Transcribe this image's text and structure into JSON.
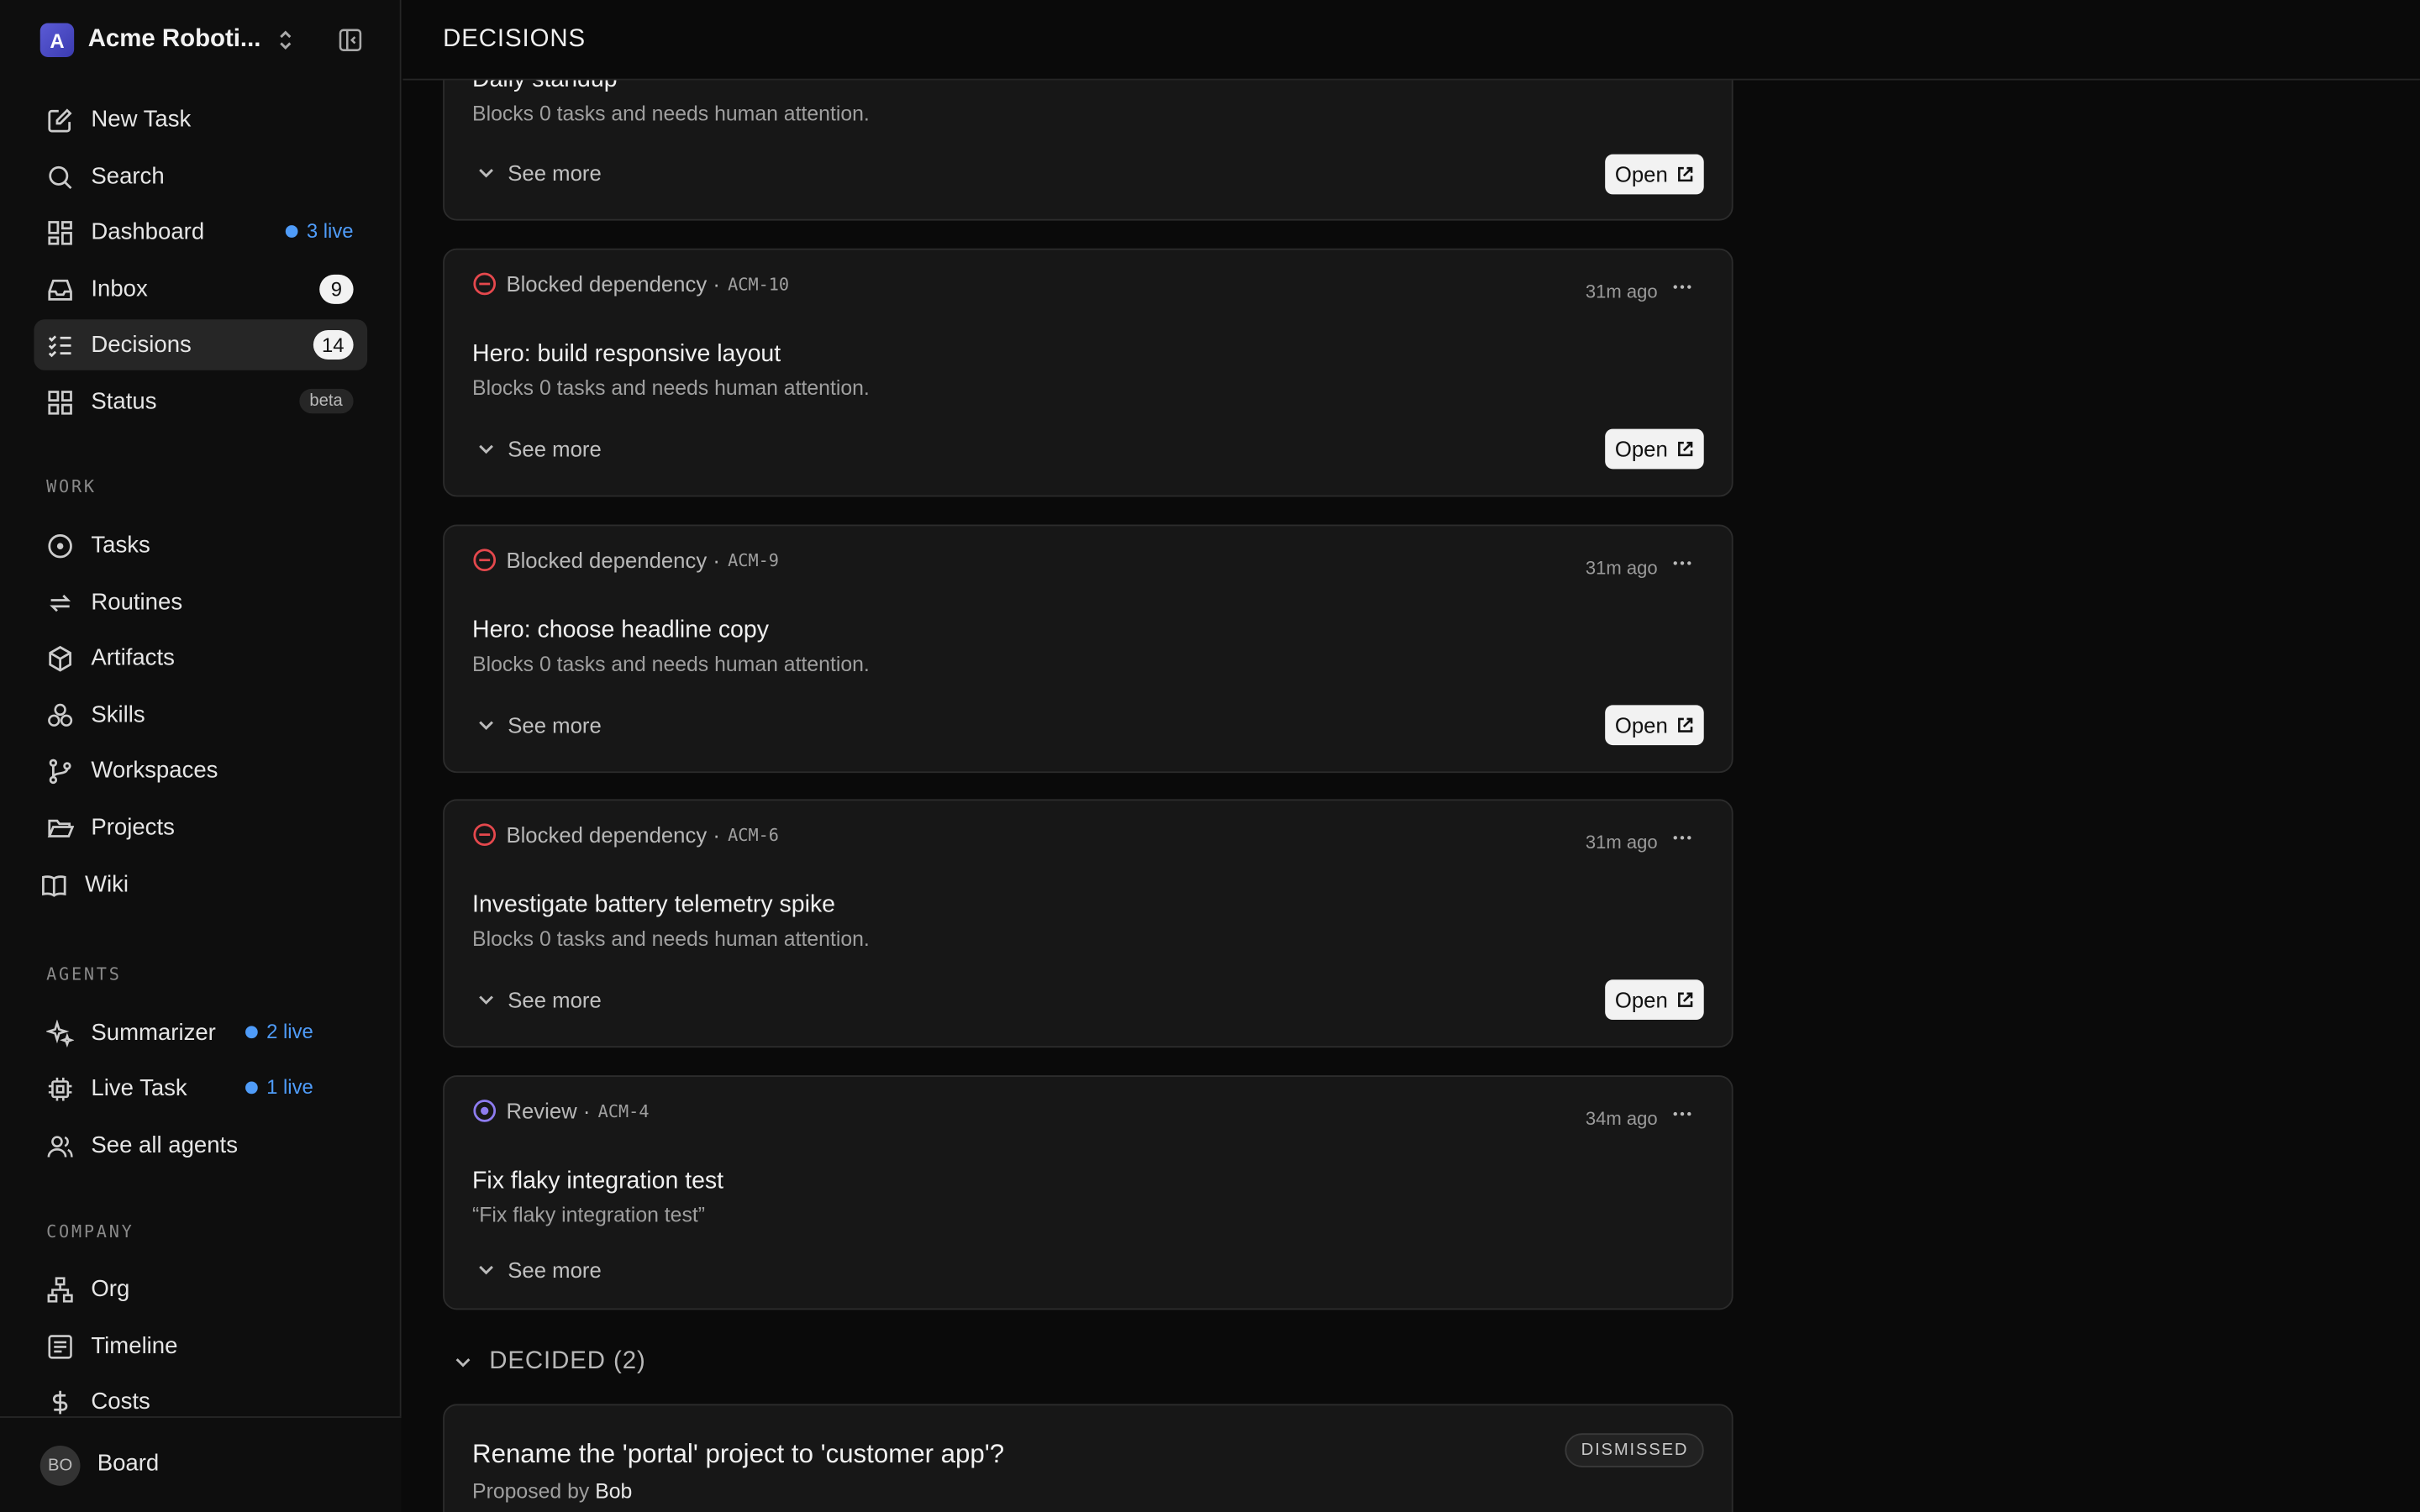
{
  "org": {
    "initial": "A",
    "name": "Acme Roboti..."
  },
  "nav": [
    {
      "label": "New Task"
    },
    {
      "label": "Search"
    },
    {
      "label": "Dashboard",
      "live": "3 live"
    },
    {
      "label": "Inbox",
      "badge": "9"
    },
    {
      "label": "Decisions",
      "badge": "14"
    },
    {
      "label": "Status",
      "tag": "beta"
    }
  ],
  "sections": {
    "work": "WORK",
    "agents": "AGENTS",
    "company": "COMPANY"
  },
  "work": [
    {
      "label": "Tasks"
    },
    {
      "label": "Routines"
    },
    {
      "label": "Artifacts"
    },
    {
      "label": "Skills"
    },
    {
      "label": "Workspaces"
    },
    {
      "label": "Projects"
    },
    {
      "label": "Wiki"
    }
  ],
  "agents": [
    {
      "label": "Summarizer",
      "live": "2 live"
    },
    {
      "label": "Live Task",
      "live": "1 live"
    },
    {
      "label": "See all agents"
    }
  ],
  "company": [
    {
      "label": "Org"
    },
    {
      "label": "Timeline"
    },
    {
      "label": "Costs"
    }
  ],
  "footer": {
    "avatar": "BO",
    "label": "Board"
  },
  "header": {
    "title": "DECISIONS"
  },
  "cards": [
    {
      "title": "Daily standup",
      "desc": "Blocks 0 tasks and needs human attention.",
      "see_more": "See more",
      "open": "Open"
    },
    {
      "type": "Blocked dependency",
      "id": "ACM-10",
      "time": "31m ago",
      "title": "Hero: build responsive layout",
      "desc": "Blocks 0 tasks and needs human attention.",
      "see_more": "See more",
      "open": "Open"
    },
    {
      "type": "Blocked dependency",
      "id": "ACM-9",
      "time": "31m ago",
      "title": "Hero: choose headline copy",
      "desc": "Blocks 0 tasks and needs human attention.",
      "see_more": "See more",
      "open": "Open"
    },
    {
      "type": "Blocked dependency",
      "id": "ACM-6",
      "time": "31m ago",
      "title": "Investigate battery telemetry spike",
      "desc": "Blocks 0 tasks and needs human attention.",
      "see_more": "See more",
      "open": "Open"
    },
    {
      "type": "Review",
      "id": "ACM-4",
      "time": "34m ago",
      "title": "Fix flaky integration test",
      "desc": "“Fix flaky integration test”",
      "see_more": "See more"
    }
  ],
  "decided": {
    "label": "DECIDED (2)",
    "item": {
      "title": "Rename the 'portal' project to 'customer app'?",
      "status": "DISMISSED",
      "proposed_prefix": "Proposed by",
      "proposed_by": "Bob"
    }
  },
  "colors": {
    "live": "#4f9cf9",
    "blocked": "#e5484d",
    "review": "#8e7cf0"
  }
}
